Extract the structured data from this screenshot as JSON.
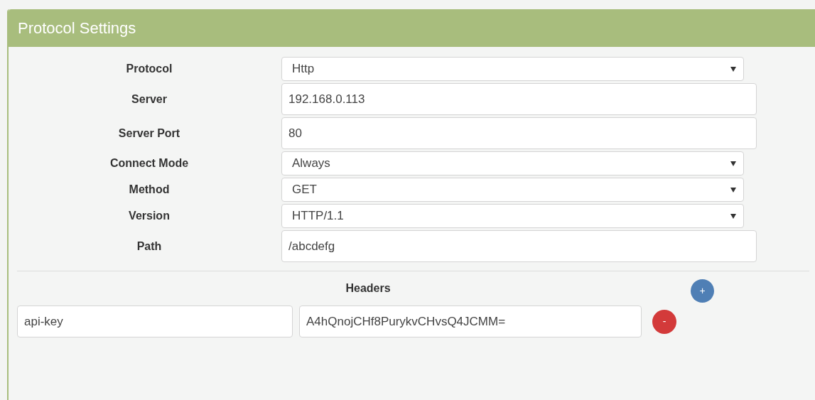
{
  "panel": {
    "title": "Protocol Settings"
  },
  "fields": [
    {
      "label": "Protocol",
      "kind": "select",
      "value": "Http"
    },
    {
      "label": "Server",
      "kind": "text",
      "value": "192.168.0.113"
    },
    {
      "label": "Server Port",
      "kind": "text",
      "value": "80"
    },
    {
      "label": "Connect Mode",
      "kind": "select",
      "value": "Always"
    },
    {
      "label": "Method",
      "kind": "select",
      "value": "GET"
    },
    {
      "label": "Version",
      "kind": "select",
      "value": "HTTP/1.1"
    },
    {
      "label": "Path",
      "kind": "text",
      "value": "/abcdefg"
    }
  ],
  "headers": {
    "title": "Headers",
    "add_button": "+",
    "rows": [
      {
        "name": "api-key",
        "value": "A4hQnojCHf8PurykvCHvsQ4JCMM=",
        "remove_button": "-"
      }
    ]
  }
}
